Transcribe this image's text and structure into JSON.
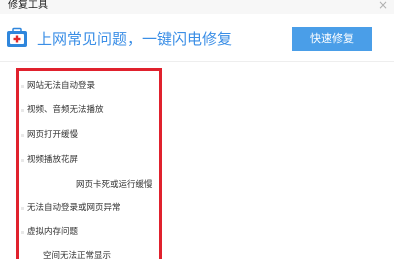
{
  "window": {
    "title": "修复工具",
    "close_glyph": "×"
  },
  "header": {
    "icon": "medical-kit-icon",
    "headline": "上网常见问题，一键闪电修复",
    "fix_button_label": "快速修复",
    "accent_color": "#3a8ee6",
    "button_color": "#4a9ee8"
  },
  "highlight_color": "#e0212d",
  "issues": {
    "items": [
      {
        "label": "网站无法自动登录"
      },
      {
        "label": "视频、音频无法播放"
      },
      {
        "label": "网页打开缓慢"
      },
      {
        "label": "视频播放花屏"
      },
      {
        "label": "网页卡死或运行缓慢"
      },
      {
        "label": "无法自动登录或网页异常"
      },
      {
        "label": "虚拟内存问题"
      },
      {
        "label": "空间无法正常显示"
      }
    ]
  }
}
